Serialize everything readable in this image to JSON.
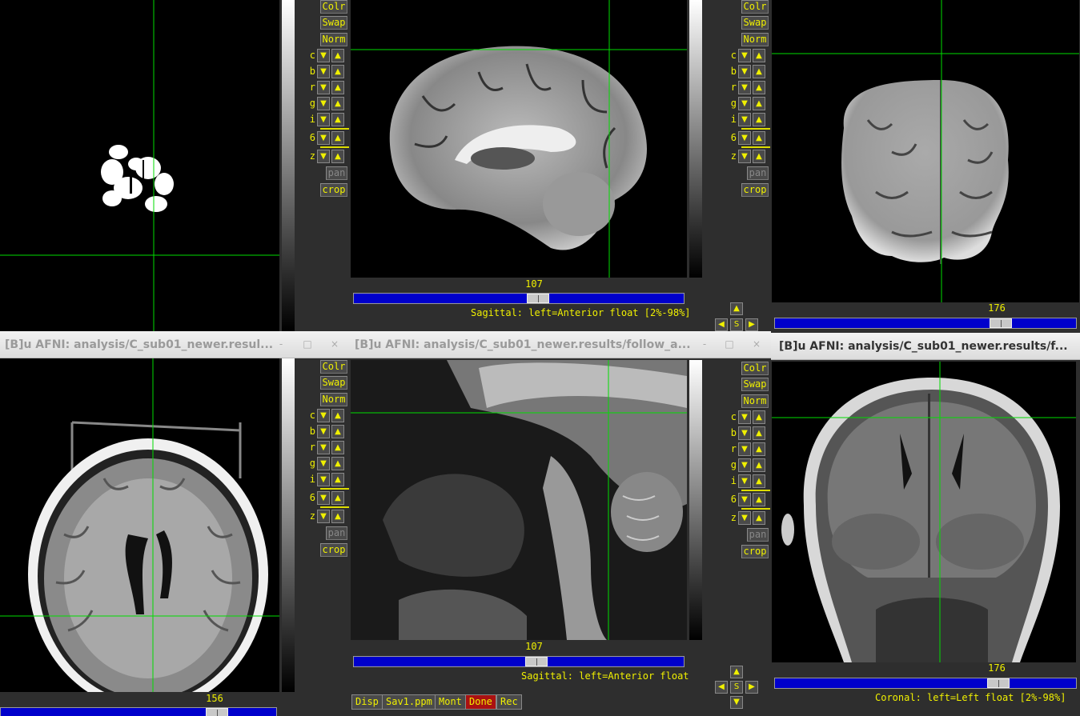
{
  "windows": {
    "top_left": {
      "controls": {
        "colr": "Colr",
        "swap": "Swap",
        "norm": "Norm",
        "pan": "pan",
        "crop": "crop"
      }
    },
    "top_mid": {
      "slider_value": "107",
      "status": "Sagittal: left=Anterior float [2%-98%]",
      "controls": {
        "colr": "Colr",
        "swap": "Swap",
        "norm": "Norm",
        "pan": "pan",
        "crop": "crop"
      }
    },
    "top_right": {
      "slider_value": "176",
      "controls": {
        "colr": "Colr",
        "swap": "Swap",
        "norm": "Norm",
        "pan": "pan",
        "crop": "crop"
      }
    },
    "bottom_left": {
      "title": "[B]u AFNI: analysis/C_sub01_newer.resul...",
      "slider_value": "156",
      "controls": {
        "colr": "Colr",
        "swap": "Swap",
        "norm": "Norm",
        "pan": "pan",
        "crop": "crop"
      }
    },
    "bottom_mid": {
      "title": "[B]u AFNI: analysis/C_sub01_newer.results/follow_a...",
      "slider_value": "107",
      "status": "Sagittal: left=Anterior float",
      "controls": {
        "colr": "Colr",
        "swap": "Swap",
        "norm": "Norm",
        "pan": "pan",
        "crop": "crop"
      },
      "buttons": {
        "disp": "Disp",
        "save": "Sav1.ppm",
        "mont": "Mont",
        "done": "Done",
        "rec": "Rec"
      }
    },
    "bottom_right": {
      "title": "[B]u AFNI: analysis/C_sub01_newer.results/f...",
      "slider_value": "176",
      "status": "Coronal: left=Left float [2%-98%]",
      "controls": {
        "colr": "Colr",
        "swap": "Swap",
        "norm": "Norm",
        "pan": "pan",
        "crop": "crop"
      }
    }
  },
  "row_labels": [
    "c",
    "b",
    "r",
    "g",
    "i",
    "6",
    "z"
  ],
  "window_buttons": {
    "minimize": "-",
    "maximize": "□",
    "close": "×"
  },
  "s_label": "S",
  "colors": {
    "crosshair": "#00dd00",
    "label_yellow": "#f0f000",
    "slider_blue": "#0000cc",
    "done_red": "#aa1111"
  }
}
